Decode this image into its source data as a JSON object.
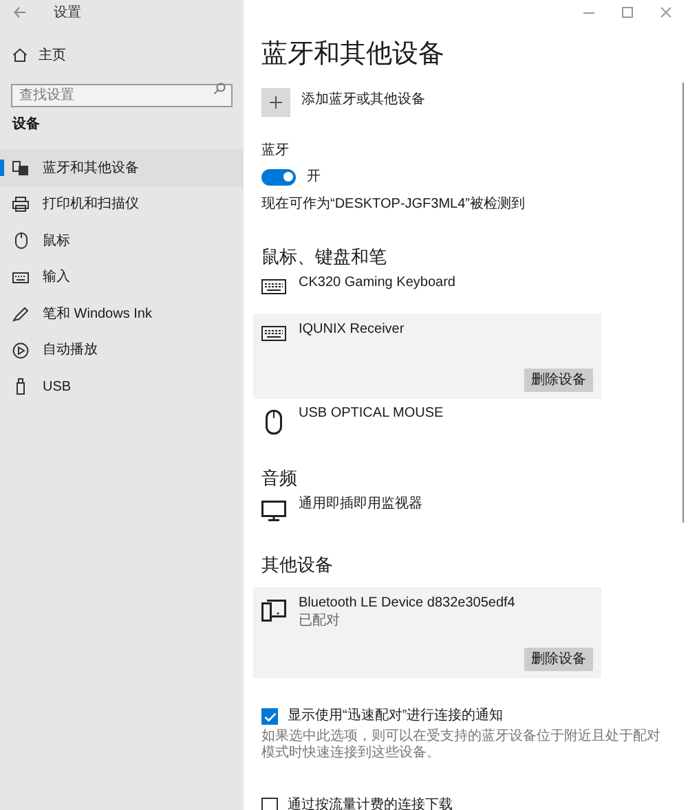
{
  "window": {
    "title": "设置"
  },
  "sidebar": {
    "home": "主页",
    "search": {
      "placeholder": "查找设置"
    },
    "section": "设备",
    "items": [
      {
        "label": "蓝牙和其他设备",
        "kind": "devices",
        "selected": true
      },
      {
        "label": "打印机和扫描仪",
        "kind": "printer",
        "selected": false
      },
      {
        "label": "鼠标",
        "kind": "mouse",
        "selected": false
      },
      {
        "label": "输入",
        "kind": "keyboard",
        "selected": false
      },
      {
        "label": "笔和 Windows Ink",
        "kind": "pen",
        "selected": false
      },
      {
        "label": "自动播放",
        "kind": "autoplay",
        "selected": false
      },
      {
        "label": "USB",
        "kind": "usb",
        "selected": false
      }
    ]
  },
  "page": {
    "title": "蓝牙和其他设备",
    "add_button": "添加蓝牙或其他设备",
    "bluetooth": {
      "label": "蓝牙",
      "on": true,
      "state_text": "开"
    },
    "discoverable": "现在可作为“DESKTOP-JGF3ML4”被检测到",
    "groups": [
      {
        "heading": "鼠标、键盘和笔",
        "devices": [
          {
            "name": "CK320 Gaming Keyboard",
            "kind": "keyboard",
            "selected": false
          },
          {
            "name": "IQUNIX Receiver",
            "kind": "keyboard",
            "selected": true,
            "action": "删除设备"
          },
          {
            "name": "USB OPTICAL MOUSE",
            "kind": "mouse",
            "selected": false
          }
        ]
      },
      {
        "heading": "音频",
        "devices": [
          {
            "name": "通用即插即用监视器",
            "kind": "monitor",
            "selected": false
          }
        ]
      },
      {
        "heading": "其他设备",
        "devices": [
          {
            "name": "Bluetooth LE Device d832e305edf4",
            "status": "已配对",
            "kind": "device",
            "selected": true,
            "action": "删除设备"
          }
        ]
      }
    ],
    "options": [
      {
        "label": "显示使用“迅速配对”进行连接的通知",
        "checked": true,
        "description": "如果选中此选项，则可以在受支持的蓝牙设备位于附近且处于配对模式时快速连接到这些设备。"
      },
      {
        "label": "通过按流量计费的连接下载",
        "checked": false
      }
    ]
  }
}
